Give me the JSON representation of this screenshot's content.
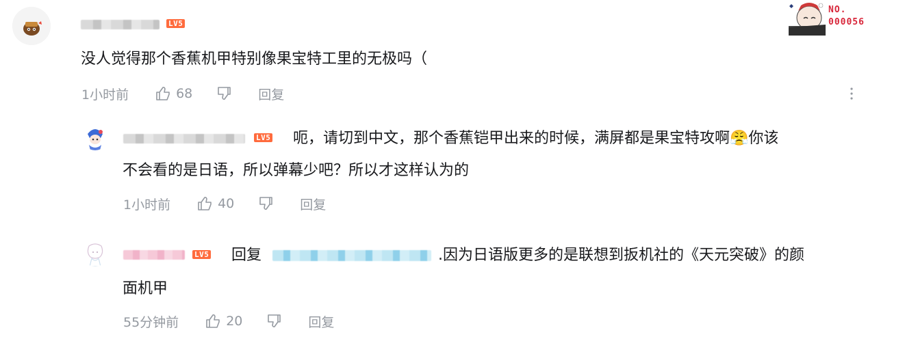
{
  "comments": [
    {
      "level": "LV5",
      "text": "没人觉得那个香蕉机甲特别像果宝特工里的无极吗（",
      "time": "1小时前",
      "likes": "68",
      "reply_label": "回复",
      "more_icon": "kebab-vertical",
      "fan_badge": {
        "line1": "NO.",
        "line2": "000056"
      }
    }
  ],
  "replies": [
    {
      "level": "LV5",
      "text_line1": "呃，请切到中文，那个香蕉铠甲出来的时候，满屏都是果宝特攻啊😤你该",
      "text_line2": "不会看的是日语，所以弹幕少吧？所以才这样认为的",
      "time": "1小时前",
      "likes": "40",
      "reply_label": "回复"
    },
    {
      "level": "LV5",
      "reply_prefix": "回复",
      "mention_tail": ".因为日语版更多的是联想到扳机社的《天元突破》的颜",
      "text_line2": "面机甲",
      "time": "55分钟前",
      "likes": "20",
      "reply_label": "回复"
    }
  ],
  "icons": {
    "like": "thumbs-up-icon",
    "dislike": "thumbs-down-icon",
    "more": "more-vertical-icon"
  },
  "colors": {
    "meta_gray": "#9499a0",
    "text": "#18191c",
    "level_badge": "#ff6b3d",
    "fan_badge": "#d8263a",
    "mention_blue": "#8fd0ea"
  }
}
